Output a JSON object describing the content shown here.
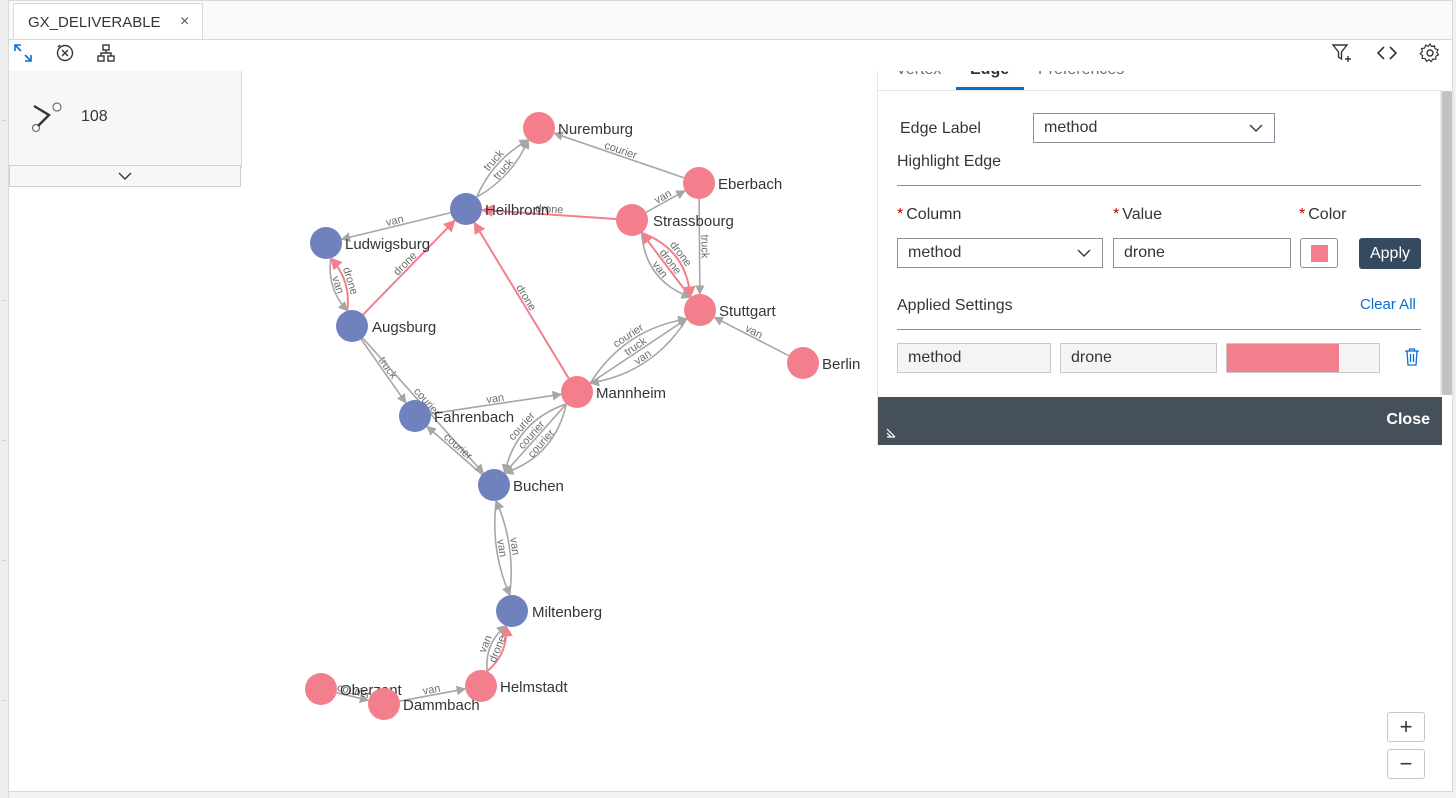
{
  "window": {
    "tab_title": "GX_DELIVERABLE",
    "tab_close": "×"
  },
  "stats": {
    "count": "108"
  },
  "panel": {
    "tabs": [
      "Vertex",
      "Edge",
      "Preferences"
    ],
    "active_tab": "Edge",
    "edge_label_label": "Edge Label",
    "edge_label_value": "method",
    "highlight_title": "Highlight Edge",
    "column_label": "Column",
    "value_label": "Value",
    "color_label": "Color",
    "required_mark": "*",
    "column_value": "method",
    "value_value": "drone",
    "apply_label": "Apply",
    "applied_title": "Applied Settings",
    "clear_all_label": "Clear All",
    "applied_rows": [
      {
        "column": "method",
        "value": "drone",
        "color": "#f47f8c",
        "fill_fraction": 0.74
      }
    ],
    "close_label": "Close"
  },
  "colors": {
    "node_blue": "#6f82bd",
    "node_pink": "#f47f8c",
    "edge_gray": "#a6a6a6",
    "edge_highlight": "#f47f8c",
    "accent": "#0a6ed1",
    "button_dark": "#354a5f",
    "footer": "#46505a"
  },
  "icons": [
    "fullscreen-icon",
    "clear-icon",
    "hierarchy-icon",
    "filter-add-icon",
    "code-icon",
    "settings-icon",
    "edge-icon",
    "chevron-down-icon",
    "trash-icon",
    "resize-icon",
    "zoom-in-icon",
    "zoom-out-icon"
  ],
  "zoom": {
    "in_label": "+",
    "out_label": "−"
  },
  "graph": {
    "nodes": [
      {
        "id": "Nuremburg",
        "label": "Nuremburg",
        "group": "pink"
      },
      {
        "id": "Eberbach",
        "label": "Eberbach",
        "group": "pink"
      },
      {
        "id": "Heilbronn",
        "label": "Heilbronn",
        "group": "blue"
      },
      {
        "id": "Strassbourg",
        "label": "Strassbourg",
        "group": "pink"
      },
      {
        "id": "Ludwigsburg",
        "label": "Ludwigsburg",
        "group": "blue"
      },
      {
        "id": "Stuttgart",
        "label": "Stuttgart",
        "group": "pink"
      },
      {
        "id": "Augsburg",
        "label": "Augsburg",
        "group": "blue"
      },
      {
        "id": "Berlin",
        "label": "Berlin",
        "group": "pink"
      },
      {
        "id": "Mannheim",
        "label": "Mannheim",
        "group": "pink"
      },
      {
        "id": "Fahrenbach",
        "label": "Fahrenbach",
        "group": "blue"
      },
      {
        "id": "Buchen",
        "label": "Buchen",
        "group": "blue"
      },
      {
        "id": "Miltenberg",
        "label": "Miltenberg",
        "group": "blue"
      },
      {
        "id": "Oberzent",
        "label": "Oberzent",
        "group": "pink"
      },
      {
        "id": "Dammbach",
        "label": "Dammbach",
        "group": "pink"
      },
      {
        "id": "Helmstadt",
        "label": "Helmstadt",
        "group": "pink"
      }
    ],
    "edges": [
      {
        "from": "Heilbronn",
        "to": "Nuremburg",
        "label": "truck",
        "highlight": false
      },
      {
        "from": "Heilbronn",
        "to": "Nuremburg",
        "label": "truck",
        "highlight": false
      },
      {
        "from": "Eberbach",
        "to": "Nuremburg",
        "label": "courier",
        "highlight": false
      },
      {
        "from": "Strassbourg",
        "to": "Eberbach",
        "label": "van",
        "highlight": false
      },
      {
        "from": "Strassbourg",
        "to": "Heilbronn",
        "label": "drone",
        "highlight": true
      },
      {
        "from": "Heilbronn",
        "to": "Ludwigsburg",
        "label": "van",
        "highlight": false
      },
      {
        "from": "Augsburg",
        "to": "Heilbronn",
        "label": "drone",
        "highlight": true
      },
      {
        "from": "Ludwigsburg",
        "to": "Augsburg",
        "label": "van",
        "highlight": false
      },
      {
        "from": "Augsburg",
        "to": "Ludwigsburg",
        "label": "drone",
        "highlight": true
      },
      {
        "from": "Mannheim",
        "to": "Heilbronn",
        "label": "drone",
        "highlight": true
      },
      {
        "from": "Strassbourg",
        "to": "Stuttgart",
        "label": "drone",
        "highlight": true
      },
      {
        "from": "Stuttgart",
        "to": "Strassbourg",
        "label": "drone",
        "highlight": true
      },
      {
        "from": "Eberbach",
        "to": "Stuttgart",
        "label": "truck",
        "highlight": false
      },
      {
        "from": "Strassbourg",
        "to": "Stuttgart",
        "label": "van",
        "highlight": false
      },
      {
        "from": "Berlin",
        "to": "Stuttgart",
        "label": "van",
        "highlight": false
      },
      {
        "from": "Mannheim",
        "to": "Stuttgart",
        "label": "courier",
        "highlight": false
      },
      {
        "from": "Mannheim",
        "to": "Stuttgart",
        "label": "truck",
        "highlight": false
      },
      {
        "from": "Stuttgart",
        "to": "Mannheim",
        "label": "van",
        "highlight": false
      },
      {
        "from": "Augsburg",
        "to": "Fahrenbach",
        "label": "truck",
        "highlight": false
      },
      {
        "from": "Augsburg",
        "to": "Buchen",
        "label": "courier",
        "highlight": false
      },
      {
        "from": "Fahrenbach",
        "to": "Mannheim",
        "label": "van",
        "highlight": false
      },
      {
        "from": "Buchen",
        "to": "Fahrenbach",
        "label": "courier",
        "highlight": false
      },
      {
        "from": "Mannheim",
        "to": "Buchen",
        "label": "courier",
        "highlight": false
      },
      {
        "from": "Mannheim",
        "to": "Buchen",
        "label": "courier",
        "highlight": false
      },
      {
        "from": "Mannheim",
        "to": "Buchen",
        "label": "courier",
        "highlight": false
      },
      {
        "from": "Miltenberg",
        "to": "Buchen",
        "label": "van",
        "highlight": false
      },
      {
        "from": "Buchen",
        "to": "Miltenberg",
        "label": "van",
        "highlight": false
      },
      {
        "from": "Helmstadt",
        "to": "Miltenberg",
        "label": "van",
        "highlight": false
      },
      {
        "from": "Helmstadt",
        "to": "Miltenberg",
        "label": "drone",
        "highlight": true
      },
      {
        "from": "Oberzent",
        "to": "Dammbach",
        "label": "courier",
        "highlight": false
      },
      {
        "from": "Dammbach",
        "to": "Helmstadt",
        "label": "van",
        "highlight": false
      }
    ]
  }
}
